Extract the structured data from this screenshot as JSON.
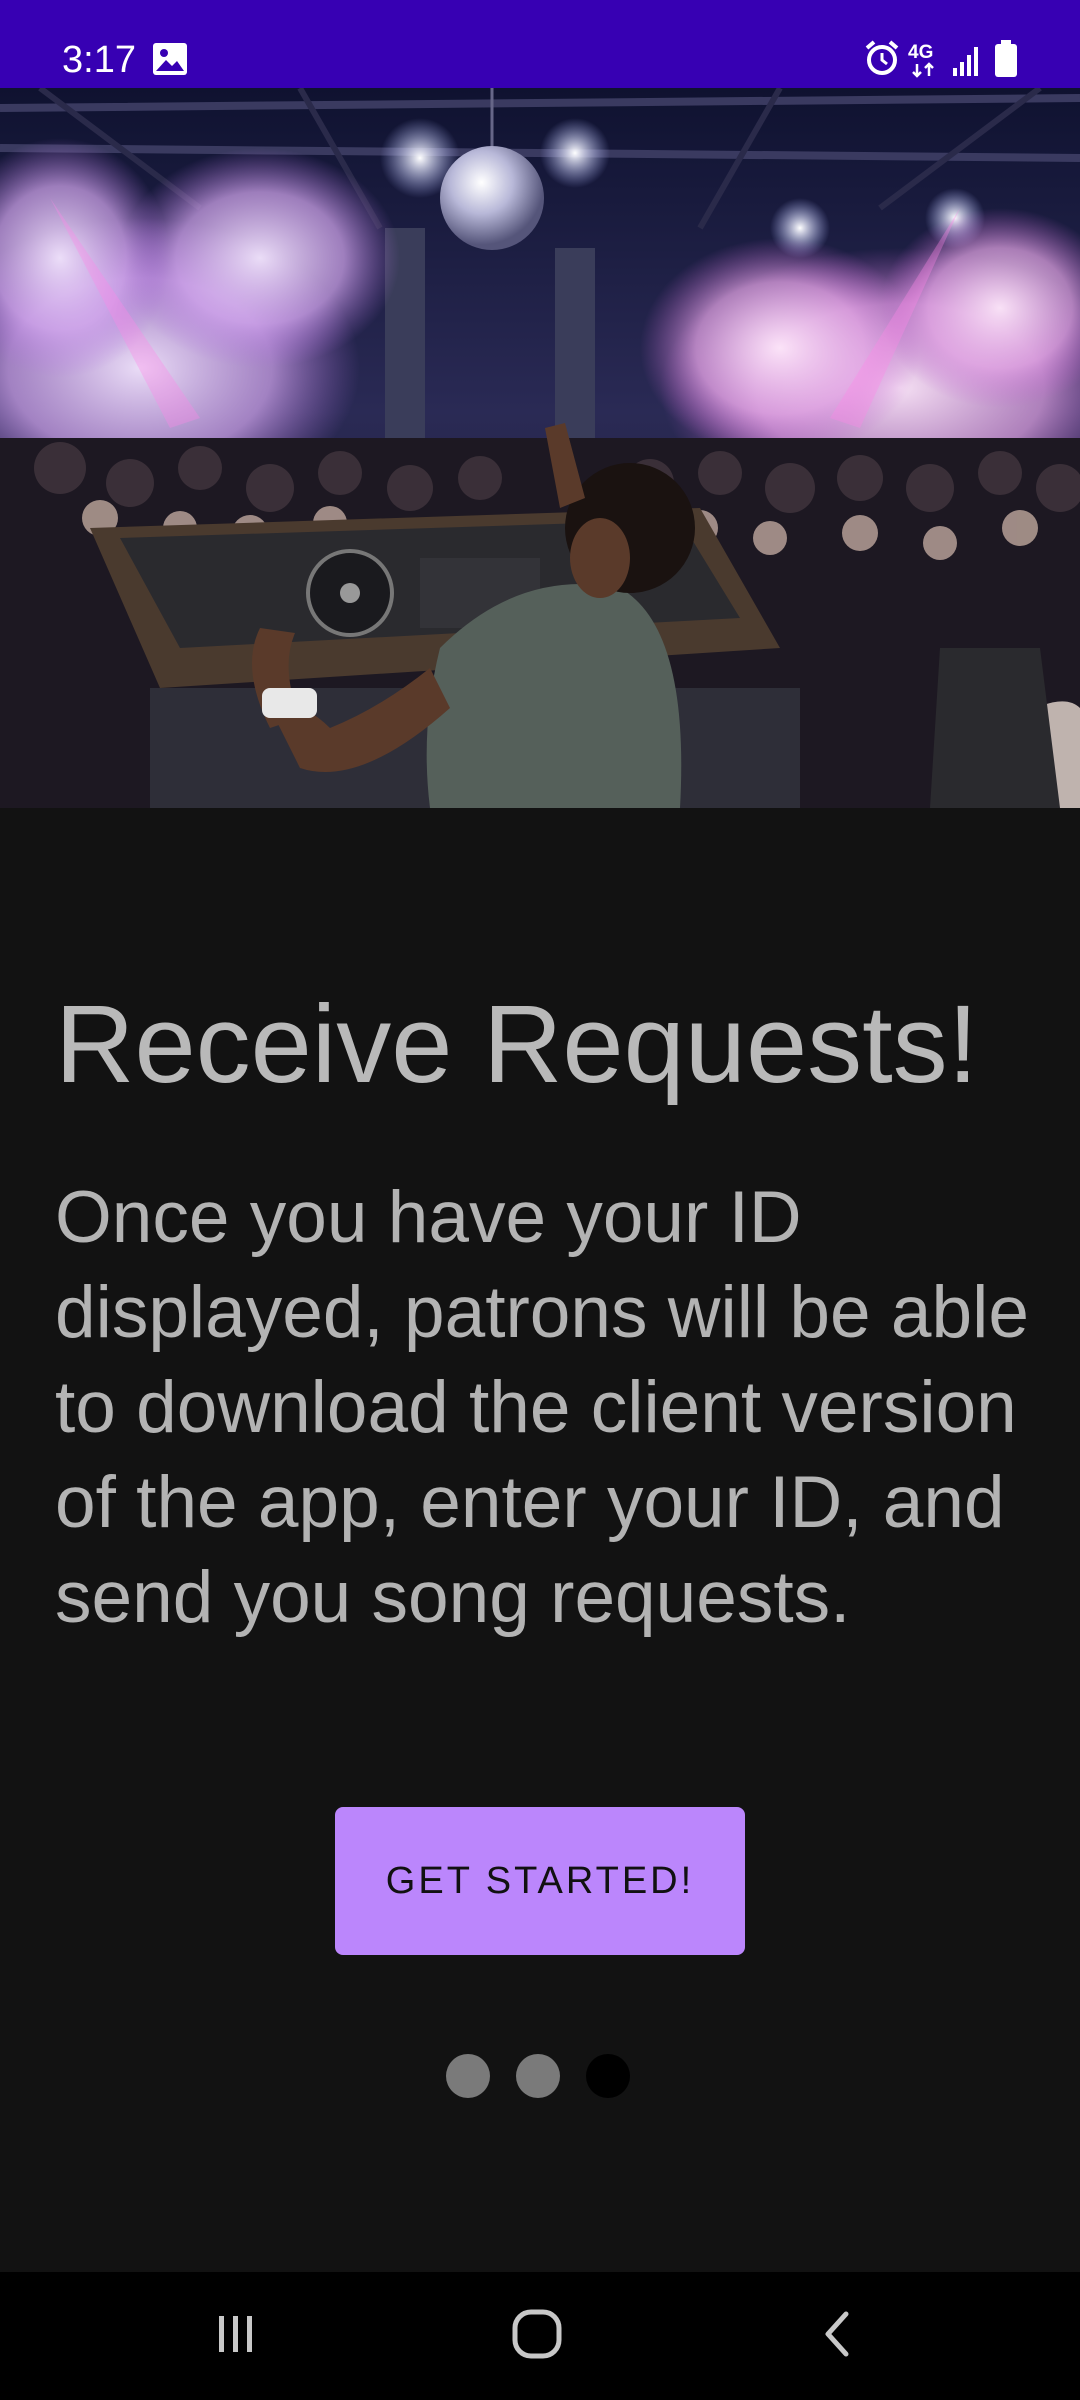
{
  "status_bar": {
    "time": "3:17",
    "network": "4G",
    "icons": [
      "gallery-icon",
      "alarm-icon",
      "network-4g-icon",
      "signal-icon",
      "battery-icon"
    ]
  },
  "hero": {
    "icon": "dj-club-photo"
  },
  "onboarding": {
    "title": "Receive Requests!",
    "body": "Once you have your ID displayed, patrons will be able to download the client version of the app, enter your ID, and send you song requests.",
    "cta_label": "GET STARTED!",
    "page_count": 3,
    "current_page": 3
  },
  "nav": {
    "icons": [
      "recents-icon",
      "home-icon",
      "back-icon"
    ]
  },
  "colors": {
    "status_bar": "#3700b3",
    "background": "#121212",
    "accent": "#bb86fc",
    "text": "#b9b9b9"
  }
}
